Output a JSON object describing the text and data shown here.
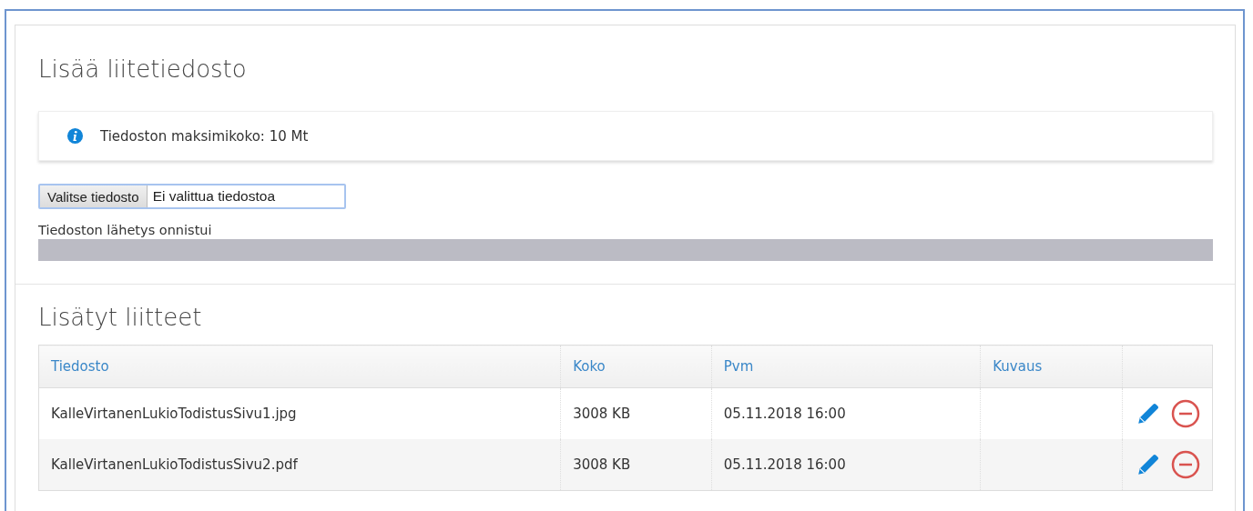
{
  "upload_section": {
    "title": "Lisää liitetiedosto",
    "info": "Tiedoston maksimikoko: 10 Mt",
    "file_button": "Valitse tiedosto",
    "file_status": "Ei valittua tiedostoa",
    "upload_message": "Tiedoston lähetys onnistui",
    "progress": {
      "level": 1
    }
  },
  "attachments_section": {
    "title": "Lisätyt liitteet",
    "table": {
      "columns": [
        "Tiedosto",
        "Koko",
        "Pvm",
        "Kuvaus"
      ],
      "rows": [
        {
          "file": "KalleVirtanenLukioTodistusSivu1.jpg",
          "size": "3008 KB",
          "date": "05.11.2018 16:00"
        },
        {
          "file": "KalleVirtanenLukioTodistusSivu2.pdf",
          "size": "3008 KB",
          "date": "05.11.2018 16:00"
        }
      ]
    }
  }
}
